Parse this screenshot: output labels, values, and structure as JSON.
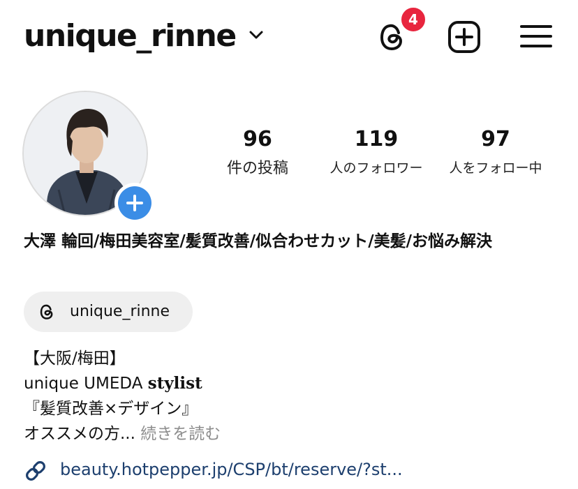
{
  "header": {
    "username": "unique_rinne",
    "threads_badge_count": "4"
  },
  "stats": {
    "posts": {
      "value": "96",
      "label": "件の投稿"
    },
    "followers": {
      "value": "119",
      "label": "人のフォロワー"
    },
    "following": {
      "value": "97",
      "label": "人をフォロー中"
    }
  },
  "profile": {
    "display_name": "大澤 輪回/梅田美容室/髪質改善/似合わせカット/美髪/お悩み解決",
    "threads_handle": "unique_rinne",
    "bio": {
      "line1": "【大阪/梅田】",
      "line2_prefix": "unique UMEDA ",
      "line2_stylist": "stylist",
      "line3": "『髪質改善×デザイン』",
      "line4": "オススメの方...",
      "more_label": "続きを読む"
    },
    "link": "beauty.hotpepper.jp/CSP/bt/reserve/?st..."
  },
  "icons": {
    "dropdown": "chevron-down-icon",
    "threads": "threads-icon",
    "create": "plus-square-icon",
    "menu": "hamburger-menu-icon",
    "avatar_add": "plus-icon",
    "link": "link-icon"
  },
  "colors": {
    "badge": "#e8253e",
    "avatar_add": "#3b8de6",
    "link": "#1d3f6e",
    "muted": "#8e8e8e",
    "chip_bg": "#efefef"
  }
}
